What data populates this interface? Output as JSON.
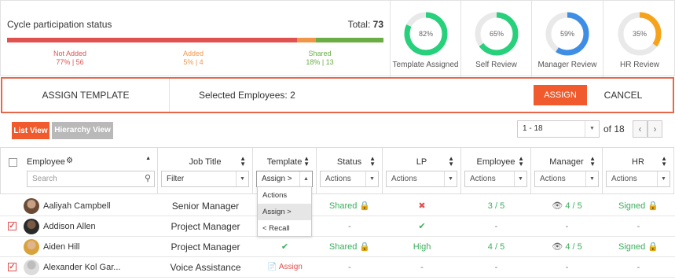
{
  "participation": {
    "title": "Cycle participation status",
    "total_label": "Total:",
    "total_value": "73",
    "not_added": {
      "label": "Not Added",
      "stat": "77% | 56",
      "pct": 77
    },
    "added": {
      "label": "Added",
      "stat": "5% | 4",
      "pct": 5
    },
    "shared": {
      "label": "Shared",
      "stat": "18% | 13",
      "pct": 18
    }
  },
  "donuts": [
    {
      "pct": 82,
      "pct_text": "82%",
      "label": "Template Assigned",
      "color": "#27d07a"
    },
    {
      "pct": 65,
      "pct_text": "65%",
      "label": "Self Review",
      "color": "#27d07a"
    },
    {
      "pct": 59,
      "pct_text": "59%",
      "label": "Manager Review",
      "color": "#3e8ee6"
    },
    {
      "pct": 35,
      "pct_text": "35%",
      "label": "HR Review",
      "color": "#f7a21b"
    }
  ],
  "assign_bar": {
    "assign_template": "ASSIGN TEMPLATE",
    "selected_label": "Selected Employees: 2",
    "assign_button": "ASSIGN",
    "cancel_button": "CANCEL"
  },
  "view": {
    "list_view": "List View",
    "hierarchy_view": "Hierarchy View"
  },
  "pager": {
    "range": "1 - 18",
    "of_text": "of 18"
  },
  "columns": {
    "employee": "Employee",
    "search_placeholder": "Search",
    "job_title": "Job Title",
    "job_filter": "Filter",
    "template": "Template",
    "template_filter": "Assign >",
    "status": "Status",
    "lp": "LP",
    "employee_review": "Employee",
    "manager": "Manager",
    "hr": "HR",
    "actions": "Actions"
  },
  "template_menu": [
    "Actions",
    "Assign >",
    "< Recall"
  ],
  "rows": [
    {
      "name": "Aaliyah Campbell",
      "job": "Senior Manager",
      "checked": false,
      "template": "",
      "status": "Shared",
      "lp": "✖",
      "employee": "3 / 5",
      "manager": "4 / 5",
      "hr": "Signed"
    },
    {
      "name": "Addison Allen",
      "job": "Project Manager",
      "checked": true,
      "template": "",
      "status": "-",
      "lp": "✔",
      "employee": "-",
      "manager": "-",
      "hr": "-"
    },
    {
      "name": "Aiden Hill",
      "job": "Project Manager",
      "checked": false,
      "template": "✔",
      "status": "Shared",
      "lp": "High",
      "employee": "4 / 5",
      "manager": "4 / 5",
      "hr": "Signed"
    },
    {
      "name": "Alexander Kol Gar...",
      "job": "Voice Assistance",
      "checked": true,
      "template": "Assign",
      "status": "-",
      "lp": "-",
      "employee": "-",
      "manager": "-",
      "hr": "-"
    }
  ]
}
